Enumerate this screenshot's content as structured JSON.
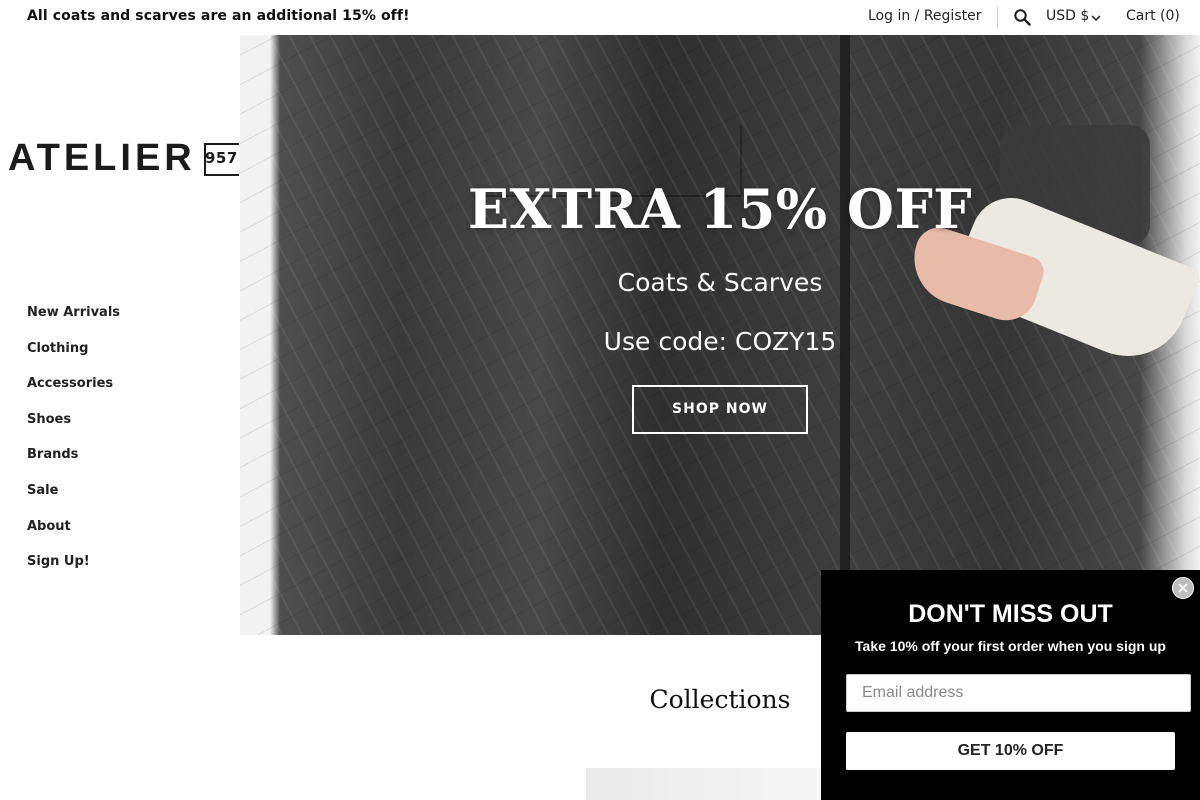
{
  "announcement": "All coats and scarves are an additional 15% off!",
  "header": {
    "login_register": "Log in / Register",
    "currency": "USD $",
    "cart": "Cart (0)",
    "icons": {
      "search": "search-icon",
      "currency_dropdown": "chevron-down-icon"
    }
  },
  "logo": {
    "word": "ATELIER",
    "number": "957"
  },
  "nav": {
    "items": [
      {
        "label": "New Arrivals"
      },
      {
        "label": "Clothing"
      },
      {
        "label": "Accessories"
      },
      {
        "label": "Shoes"
      },
      {
        "label": "Brands"
      },
      {
        "label": "Sale"
      },
      {
        "label": "About"
      },
      {
        "label": "Sign Up!"
      }
    ]
  },
  "hero": {
    "title": "EXTRA 15% OFF",
    "subtitle": "Coats & Scarves",
    "code_line": "Use code: COZY15",
    "button": "SHOP NOW"
  },
  "collections": {
    "title": "Collections"
  },
  "popup": {
    "title": "DON'T MISS OUT",
    "subtitle": "Take 10% off your first order when you sign up",
    "email_placeholder": "Email address",
    "email_value": "",
    "button": "GET 10% OFF",
    "close_icon": "close-icon"
  },
  "colors": {
    "background": "#ffffff",
    "text": "#1a1a1a",
    "popup_bg": "#000000",
    "popup_text": "#ffffff",
    "hero_text": "#ffffff"
  }
}
